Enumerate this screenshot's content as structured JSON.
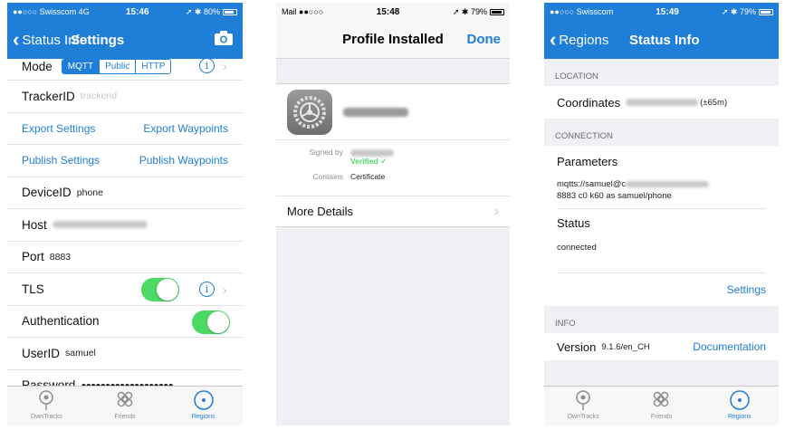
{
  "colors": {
    "accent": "#1f7ed8",
    "toggle_on": "#4cd964",
    "verified": "#4cd964"
  },
  "screen1": {
    "status": {
      "carrier": "●●○○○ Swisscom  4G",
      "time": "15:46",
      "battery": "➚ ✱ 80%"
    },
    "nav": {
      "back_label": "Status Info",
      "title": "Settings",
      "right_icon": "camera-icon"
    },
    "mode": {
      "label": "Mode",
      "options": [
        "MQTT",
        "Public",
        "HTTP"
      ],
      "selected": "MQTT"
    },
    "tracker": {
      "label": "TrackerID",
      "placeholder": "trackerid"
    },
    "export_settings": "Export Settings",
    "export_waypoints": "Export Waypoints",
    "publish_settings": "Publish Settings",
    "publish_waypoints": "Publish Waypoints",
    "device": {
      "label": "DeviceID",
      "value": "phone"
    },
    "host": {
      "label": "Host"
    },
    "port": {
      "label": "Port",
      "value": "8883"
    },
    "tls": {
      "label": "TLS",
      "on": true
    },
    "auth": {
      "label": "Authentication",
      "on": true
    },
    "user": {
      "label": "UserID",
      "value": "samuel"
    },
    "password": {
      "label": "Password",
      "value": "●●●●●●●●●●●●●●●●●●●"
    }
  },
  "screen2": {
    "status": {
      "carrier": "Mail ●●○○○",
      "time": "15:48",
      "battery": "➚ ✱ 79%"
    },
    "nav": {
      "title": "Profile Installed",
      "done": "Done"
    },
    "signed_by_label": "Signed by",
    "verified": "Verified ✓",
    "contains_label": "Contains",
    "contains_value": "Certificate",
    "more_details": "More Details"
  },
  "screen3": {
    "status": {
      "carrier": "●●○○○ Swisscom",
      "time": "15:49",
      "battery": "➚ ✱ 79%"
    },
    "nav": {
      "back_label": "Regions",
      "title": "Status Info"
    },
    "location_header": "LOCATION",
    "coordinates_label": "Coordinates",
    "coordinates_accuracy": "(±65m)",
    "connection_header": "CONNECTION",
    "parameters_label": "Parameters",
    "parameters_line1": "mqtts://samuel@c",
    "parameters_line2": "8883 c0 k60 as samuel/phone",
    "status_label": "Status",
    "status_value": "connected",
    "settings_link": "Settings",
    "info_header": "INFO",
    "version_label": "Version",
    "version_value": "9.1.6/en_CH",
    "documentation_link": "Documentation"
  },
  "tabbar": [
    {
      "label": "OwnTracks",
      "icon": "pin-icon"
    },
    {
      "label": "Friends",
      "icon": "friends-icon"
    },
    {
      "label": "Regions",
      "icon": "regions-icon"
    }
  ]
}
